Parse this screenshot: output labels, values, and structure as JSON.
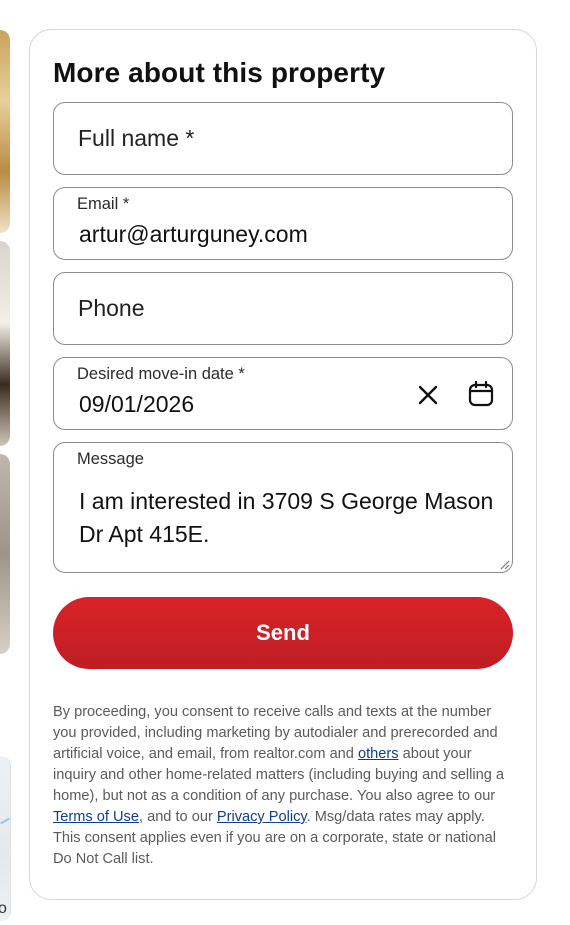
{
  "form": {
    "title": "More about this property",
    "full_name": {
      "placeholder": "Full name *",
      "value": ""
    },
    "email": {
      "label": "Email *",
      "value": "artur@arturguney.com"
    },
    "phone": {
      "placeholder": "Phone",
      "value": ""
    },
    "move_in_date": {
      "label": "Desired move-in date *",
      "value": "09/01/2026",
      "clear_icon": "close-icon",
      "calendar_icon": "calendar-icon"
    },
    "message": {
      "label": "Message",
      "value": "I am interested in 3709 S George Mason Dr Apt 415E."
    },
    "send_label": "Send"
  },
  "legal": {
    "part1": "By proceeding, you consent to receive calls and texts at the number you provided, including marketing by autodialer and prerecorded and artificial voice, and email, from realtor.com and ",
    "others_link": "others",
    "part2": " about your inquiry and other home-related matters (including buying and selling a home), but not as a condition of any purchase. You also agree to our ",
    "terms_link": "Terms of Use",
    "part3": ", and to our ",
    "privacy_link": "Privacy Policy",
    "part4": ". Msg/data rates may apply. This consent applies even if you are on a corporate, state or national Do Not Call list."
  },
  "colors": {
    "brand_red": "#d92228",
    "link_blue": "#0f3f8c",
    "border": "#8c8c8c"
  }
}
